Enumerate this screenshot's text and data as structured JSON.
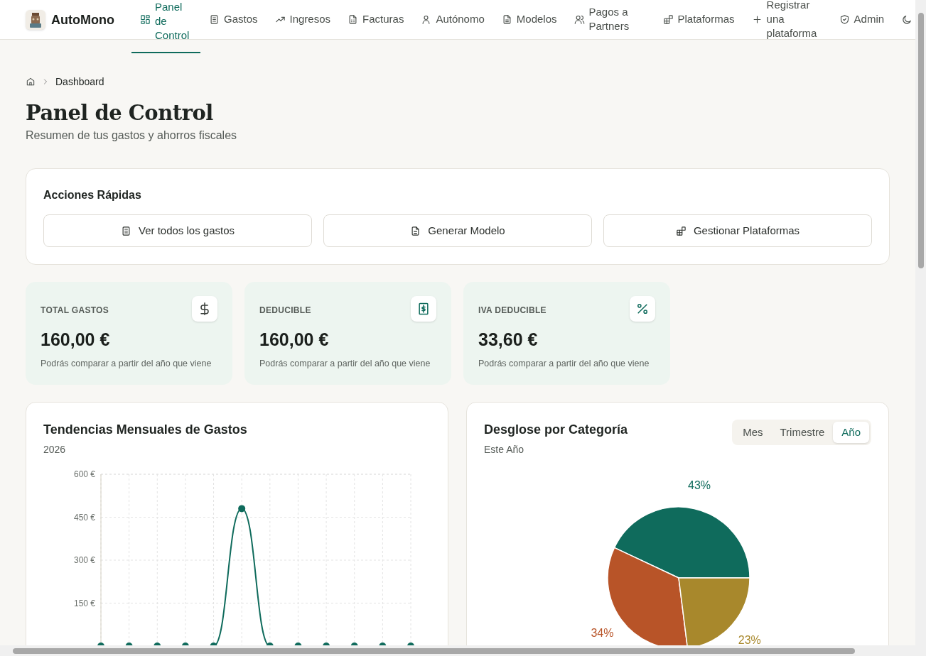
{
  "header": {
    "brand": "AutoMono",
    "nav": [
      {
        "label": "Panel de Control",
        "selected": true
      },
      {
        "label": "Gastos",
        "selected": false
      },
      {
        "label": "Ingresos",
        "selected": false
      },
      {
        "label": "Facturas",
        "selected": false
      },
      {
        "label": "Autónomo",
        "selected": false
      },
      {
        "label": "Modelos",
        "selected": false
      },
      {
        "label": "Pagos a Partners",
        "selected": false
      },
      {
        "label": "Plataformas",
        "selected": false
      },
      {
        "label": "Registrar una plataforma",
        "selected": false
      },
      {
        "label": "Admin",
        "selected": false
      }
    ]
  },
  "breadcrumb": [
    "Dashboard"
  ],
  "page": {
    "title": "Panel de Control",
    "subtitle": "Resumen de tus gastos y ahorros fiscales"
  },
  "quick_actions": {
    "title": "Acciones Rápidas",
    "buttons": [
      "Ver todos los gastos",
      "Generar Modelo",
      "Gestionar Plataformas"
    ]
  },
  "stats": [
    {
      "label": "TOTAL GASTOS",
      "value": "160,00 €",
      "note": "Podrás comparar a partir del año que viene"
    },
    {
      "label": "DEDUCIBLE",
      "value": "160,00 €",
      "note": "Podrás comparar a partir del año que viene"
    },
    {
      "label": "IVA DEDUCIBLE",
      "value": "33,60 €",
      "note": "Podrás comparar a partir del año que viene"
    }
  ],
  "trend": {
    "title": "Tendencias Mensuales de Gastos",
    "subtitle": "2026",
    "chart_data": {
      "type": "line",
      "grid": true,
      "series": [
        {
          "color": "#0f6b5c",
          "marker": true,
          "values": [
            0,
            0,
            0,
            0,
            0,
            480,
            0,
            0,
            0,
            0,
            0,
            0
          ]
        }
      ],
      "ylim": [
        0,
        600
      ],
      "yticks": [
        {
          "value": 150,
          "label": "150 €"
        },
        {
          "value": 300,
          "label": "300 €"
        },
        {
          "value": 450,
          "label": "450 €"
        },
        {
          "value": 600,
          "label": "600 €"
        }
      ]
    }
  },
  "breakdown": {
    "title": "Desglose por Categoría",
    "subtitle": "Este Año",
    "periods": [
      {
        "label": "Mes",
        "selected": false
      },
      {
        "label": "Trimestre",
        "selected": false
      },
      {
        "label": "Año",
        "selected": true
      }
    ],
    "chart_data": {
      "type": "pie",
      "values": [
        43,
        34,
        23
      ],
      "colors": [
        "#0f6b5c",
        "#b85428",
        "#a8882c"
      ],
      "value_labels": [
        "43%",
        "34%",
        "23%"
      ]
    }
  }
}
